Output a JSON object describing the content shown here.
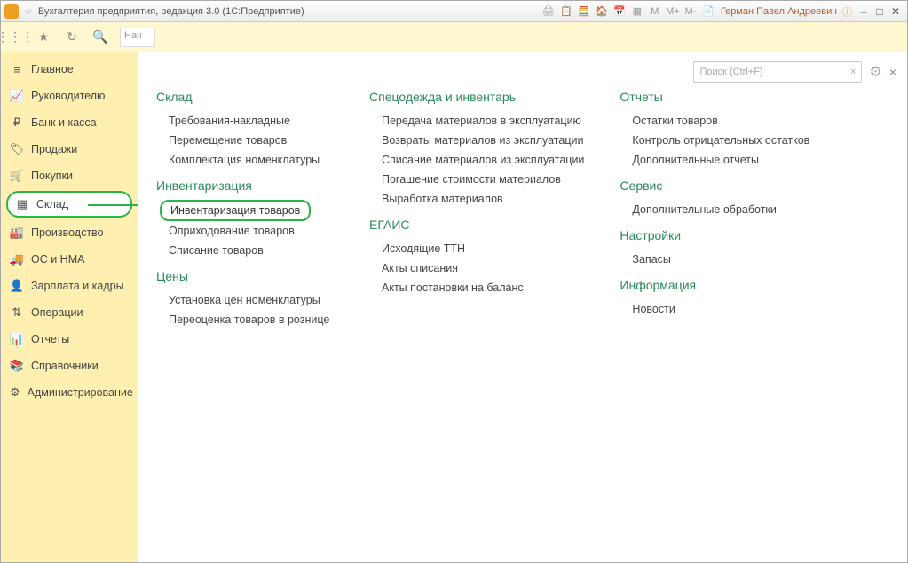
{
  "titlebar": {
    "title": "Бухгалтерия предприятия, редакция 3.0  (1С:Предприятие)",
    "user": "Герман Павел Андреевич"
  },
  "toolbar": {
    "search_hint": "Нач"
  },
  "search": {
    "placeholder": "Поиск (Ctrl+F)"
  },
  "sidebar": {
    "items": [
      {
        "icon": "≡",
        "label": "Главное"
      },
      {
        "icon": "📈",
        "label": "Руководителю"
      },
      {
        "icon": "₽",
        "label": "Банк и касса"
      },
      {
        "icon": "🏷",
        "label": "Продажи"
      },
      {
        "icon": "🛒",
        "label": "Покупки"
      },
      {
        "icon": "▦",
        "label": "Склад"
      },
      {
        "icon": "🏭",
        "label": "Производство"
      },
      {
        "icon": "🚚",
        "label": "ОС и НМА"
      },
      {
        "icon": "👤",
        "label": "Зарплата и кадры"
      },
      {
        "icon": "⇅",
        "label": "Операции"
      },
      {
        "icon": "📊",
        "label": "Отчеты"
      },
      {
        "icon": "📚",
        "label": "Справочники"
      },
      {
        "icon": "⚙",
        "label": "Администрирование"
      }
    ],
    "active_index": 5
  },
  "panel": {
    "col1": [
      {
        "title": "Склад",
        "links": [
          "Требования-накладные",
          "Перемещение товаров",
          "Комплектация номенклатуры"
        ]
      },
      {
        "title": "Инвентаризация",
        "links": [
          "Инвентаризация товаров",
          "Оприходование товаров",
          "Списание товаров"
        ],
        "highlight_index": 0
      },
      {
        "title": "Цены",
        "links": [
          "Установка цен номенклатуры",
          "Переоценка товаров в рознице"
        ]
      }
    ],
    "col2": [
      {
        "title": "Спецодежда и инвентарь",
        "links": [
          "Передача материалов в эксплуатацию",
          "Возвраты материалов из эксплуатации",
          "Списание материалов из эксплуатации",
          "Погашение стоимости материалов",
          "Выработка материалов"
        ]
      },
      {
        "title": "ЕГАИС",
        "links": [
          "Исходящие ТТН",
          "Акты списания",
          "Акты постановки на баланс"
        ]
      }
    ],
    "col3": [
      {
        "title": "Отчеты",
        "links": [
          "Остатки товаров",
          "Контроль отрицательных остатков",
          "Дополнительные отчеты"
        ]
      },
      {
        "title": "Сервис",
        "links": [
          "Дополнительные обработки"
        ]
      },
      {
        "title": "Настройки",
        "links": [
          "Запасы"
        ]
      },
      {
        "title": "Информация",
        "links": [
          "Новости"
        ]
      }
    ]
  }
}
